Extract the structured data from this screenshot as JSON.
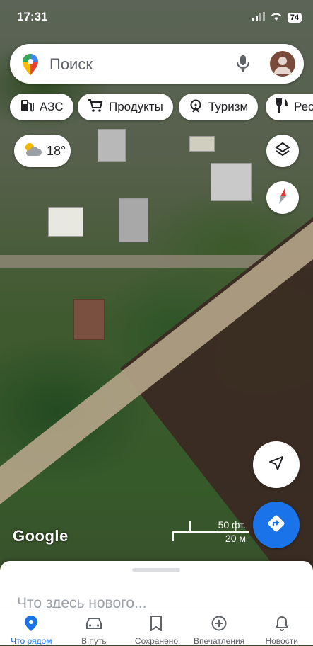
{
  "status_bar": {
    "time": "17:31",
    "battery": "74"
  },
  "search": {
    "placeholder": "Поиск"
  },
  "chips": [
    {
      "label": "АЗС",
      "icon": "fuel-pump-icon"
    },
    {
      "label": "Продукты",
      "icon": "shopping-cart-icon"
    },
    {
      "label": "Туризм",
      "icon": "attractions-icon"
    },
    {
      "label": "Рес",
      "icon": "restaurant-icon"
    }
  ],
  "weather": {
    "temperature": "18°",
    "icon": "partly-cloudy-icon"
  },
  "map": {
    "attribution": "Google",
    "scale_feet": "50 фт.",
    "scale_meters": "20 м"
  },
  "sheet": {
    "title": "Что здесь нового..."
  },
  "tabs": [
    {
      "label": "Что рядом",
      "icon": "location-pin-icon",
      "active": true
    },
    {
      "label": "В путь",
      "icon": "car-icon",
      "active": false
    },
    {
      "label": "Сохранено",
      "icon": "bookmark-icon",
      "active": false
    },
    {
      "label": "Впечатления",
      "icon": "add-circle-icon",
      "active": false
    },
    {
      "label": "Новости",
      "icon": "bell-icon",
      "active": false
    }
  ],
  "colors": {
    "accent": "#1a73e8",
    "compass_red": "#e53935"
  }
}
